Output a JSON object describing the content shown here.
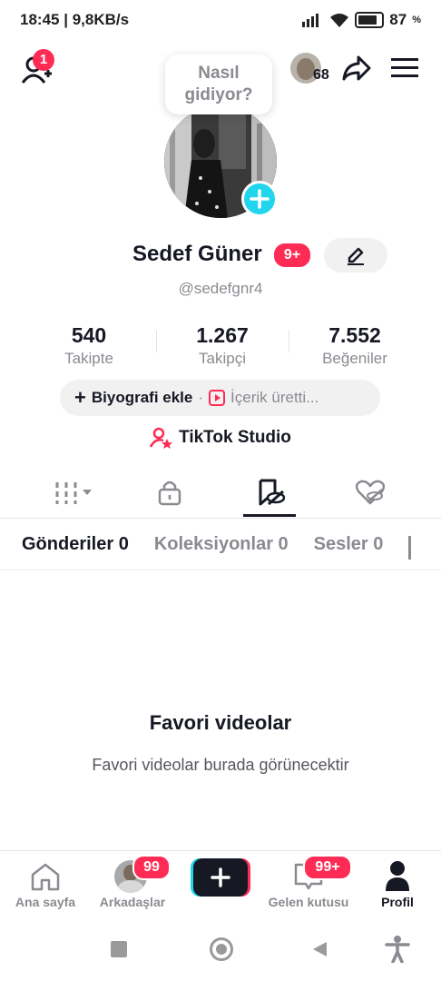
{
  "status_bar": {
    "time": "18:45",
    "network_speed": "9,8KB/s",
    "battery": "87"
  },
  "header": {
    "add_friend_badge": "1",
    "visitor_count": "68"
  },
  "profile": {
    "bubble_text": "Nasıl gidiyor?",
    "name": "Sedef Güner",
    "name_badge": "9+",
    "handle": "@sedefgnr4"
  },
  "stats": [
    {
      "value": "540",
      "label": "Takipte"
    },
    {
      "value": "1.267",
      "label": "Takipçi"
    },
    {
      "value": "7.552",
      "label": "Beğeniler"
    }
  ],
  "bio": {
    "add_label": "Biyografi ekle",
    "separator": "·",
    "creator_label": "İçerik üretti..."
  },
  "studio_label": "TikTok Studio",
  "subtabs": [
    "Gönderiler 0",
    "Koleksiyonlar 0",
    "Sesler 0"
  ],
  "empty_state": {
    "title": "Favori videolar",
    "description": "Favori videolar burada görünecektir"
  },
  "bottom_nav": {
    "home": "Ana sayfa",
    "friends": "Arkadaşlar",
    "friends_badge": "99",
    "inbox": "Gelen kutusu",
    "inbox_badge": "99+",
    "profile": "Profil"
  },
  "colors": {
    "accent": "#fe2c55",
    "cyan": "#20d5ec",
    "text": "#161823",
    "muted": "#8a8b91"
  },
  "icons": [
    "add-friend-icon",
    "share-icon",
    "menu-icon",
    "edit-icon",
    "lock-icon",
    "favorites-icon",
    "liked-icon",
    "grid-icon",
    "home-icon",
    "inbox-icon",
    "create-icon",
    "studio-icon"
  ]
}
